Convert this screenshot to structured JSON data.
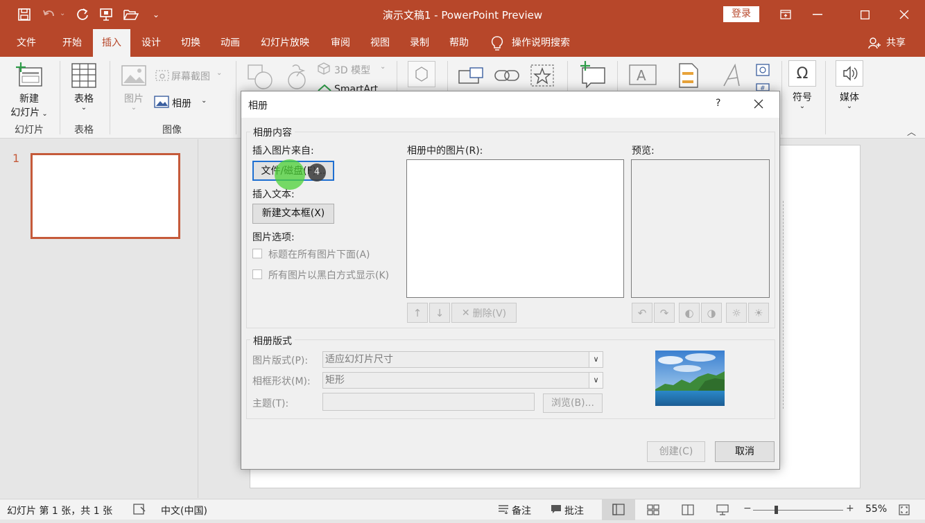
{
  "window": {
    "title": "演示文稿1  -  PowerPoint Preview",
    "login": "登录"
  },
  "quick_access": {
    "icons": [
      "save-icon",
      "undo-icon",
      "redo-icon",
      "present-icon",
      "open-icon",
      "customize-icon"
    ]
  },
  "menu": {
    "items": [
      "文件",
      "开始",
      "插入",
      "设计",
      "切换",
      "动画",
      "幻灯片放映",
      "审阅",
      "视图",
      "录制",
      "帮助"
    ],
    "active": "插入",
    "search": "操作说明搜索",
    "share": "共享"
  },
  "ribbon": {
    "new_slide": "新建",
    "new_slide_2": "幻灯片",
    "table": "表格",
    "picture": "图片",
    "screenshot": "屏幕截图",
    "album": "相册",
    "model_3d": "3D 模型",
    "smartart": "SmartArt",
    "symbol": "符号",
    "media": "媒体",
    "groups": {
      "slides": "幻灯片",
      "tables": "表格",
      "images": "图像"
    }
  },
  "slides_pane": {
    "slide_number": "1"
  },
  "dialog": {
    "title": "相册",
    "help": "?",
    "content_legend": "相册内容",
    "insert_from": "插入图片来自:",
    "file_disk_btn": "文件/磁盘(F)...",
    "insert_text": "插入文本:",
    "new_textbox_btn": "新建文本框(X)",
    "picture_options": "图片选项:",
    "caption_below": "标题在所有图片下面(A)",
    "black_white": "所有图片以黑白方式显示(K)",
    "pictures_in_album": "相册中的图片(R):",
    "preview": "预览:",
    "delete_btn": "删除(V)",
    "layout_legend": "相册版式",
    "picture_layout_label": "图片版式(P):",
    "picture_layout_value": "适应幻灯片尺寸",
    "frame_shape_label": "相框形状(M):",
    "frame_shape_value": "矩形",
    "theme_label": "主题(T):",
    "theme_value": "",
    "browse_btn": "浏览(B)...",
    "create_btn": "创建(C)",
    "cancel_btn": "取消",
    "cursor_badge": "4"
  },
  "statusbar": {
    "slide_info": "幻灯片 第 1 张，共 1 张",
    "language": "中文(中国)",
    "notes": "备注",
    "comments": "批注",
    "zoom": "55%",
    "zoom_fraction": 0.55
  },
  "colors": {
    "accent": "#b7472a",
    "thumb_border": "#c55a3a",
    "cursor_highlight": "#4cd137"
  }
}
